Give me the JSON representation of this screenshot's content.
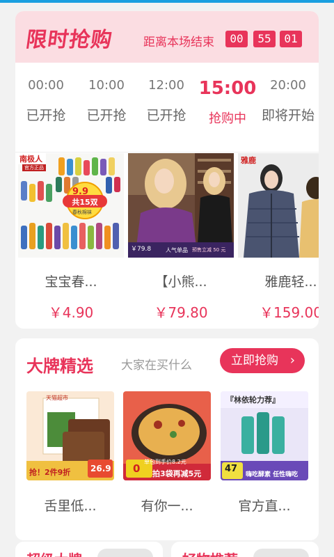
{
  "flash_sale": {
    "logo": "限时抢购",
    "countdown_label": "距离本场结束",
    "countdown": [
      "00",
      "55",
      "01"
    ],
    "sessions": [
      {
        "time": "00:00",
        "status": "已开抢"
      },
      {
        "time": "10:00",
        "status": "已开抢"
      },
      {
        "time": "12:00",
        "status": "已开抢"
      },
      {
        "time": "15:00",
        "status": "抢购中"
      },
      {
        "time": "20:00",
        "status": "即将开始"
      }
    ],
    "products": [
      {
        "name": "宝宝春...",
        "price": "￥4.90",
        "img": {
          "brand": "南极人",
          "sub": "官方正品",
          "badge_price": "9.9",
          "badge_text": "共15双",
          "badge_sub": "春秋棉袜"
        }
      },
      {
        "name": "【小熊...",
        "price": "￥79.80",
        "img": {
          "tag1": "人气单品",
          "tag2": "预售立减 50 元",
          "price_tag": "￥79.8"
        }
      },
      {
        "name": "雅鹿轻...",
        "price": "￥159.00",
        "img": {
          "brand": "雅鹿"
        }
      }
    ]
  },
  "brand": {
    "title": "大牌精选",
    "subtitle": "大家在买什么",
    "button": "立即抢购",
    "products": [
      {
        "name": "舌里低...",
        "img": {
          "tag": "天猫超市",
          "promo": "抢！2件9折",
          "price": "26.9"
        }
      },
      {
        "name": "有你一...",
        "img": {
          "promo": "拍3袋再减5元",
          "sub": "单包到手价8.2元",
          "price": "0"
        }
      },
      {
        "name": "官方直...",
        "img": {
          "title": "『林依轮力荐』",
          "promo": "嗨吃酵素 任性嗨吃",
          "price": "47"
        }
      }
    ]
  },
  "bottom": {
    "left_title": "超级大牌",
    "right_title": "好物推荐"
  },
  "colors": {
    "accent": "#e8345a",
    "header_bg": "#fbdde2",
    "topbar": "#1a9fe0"
  }
}
